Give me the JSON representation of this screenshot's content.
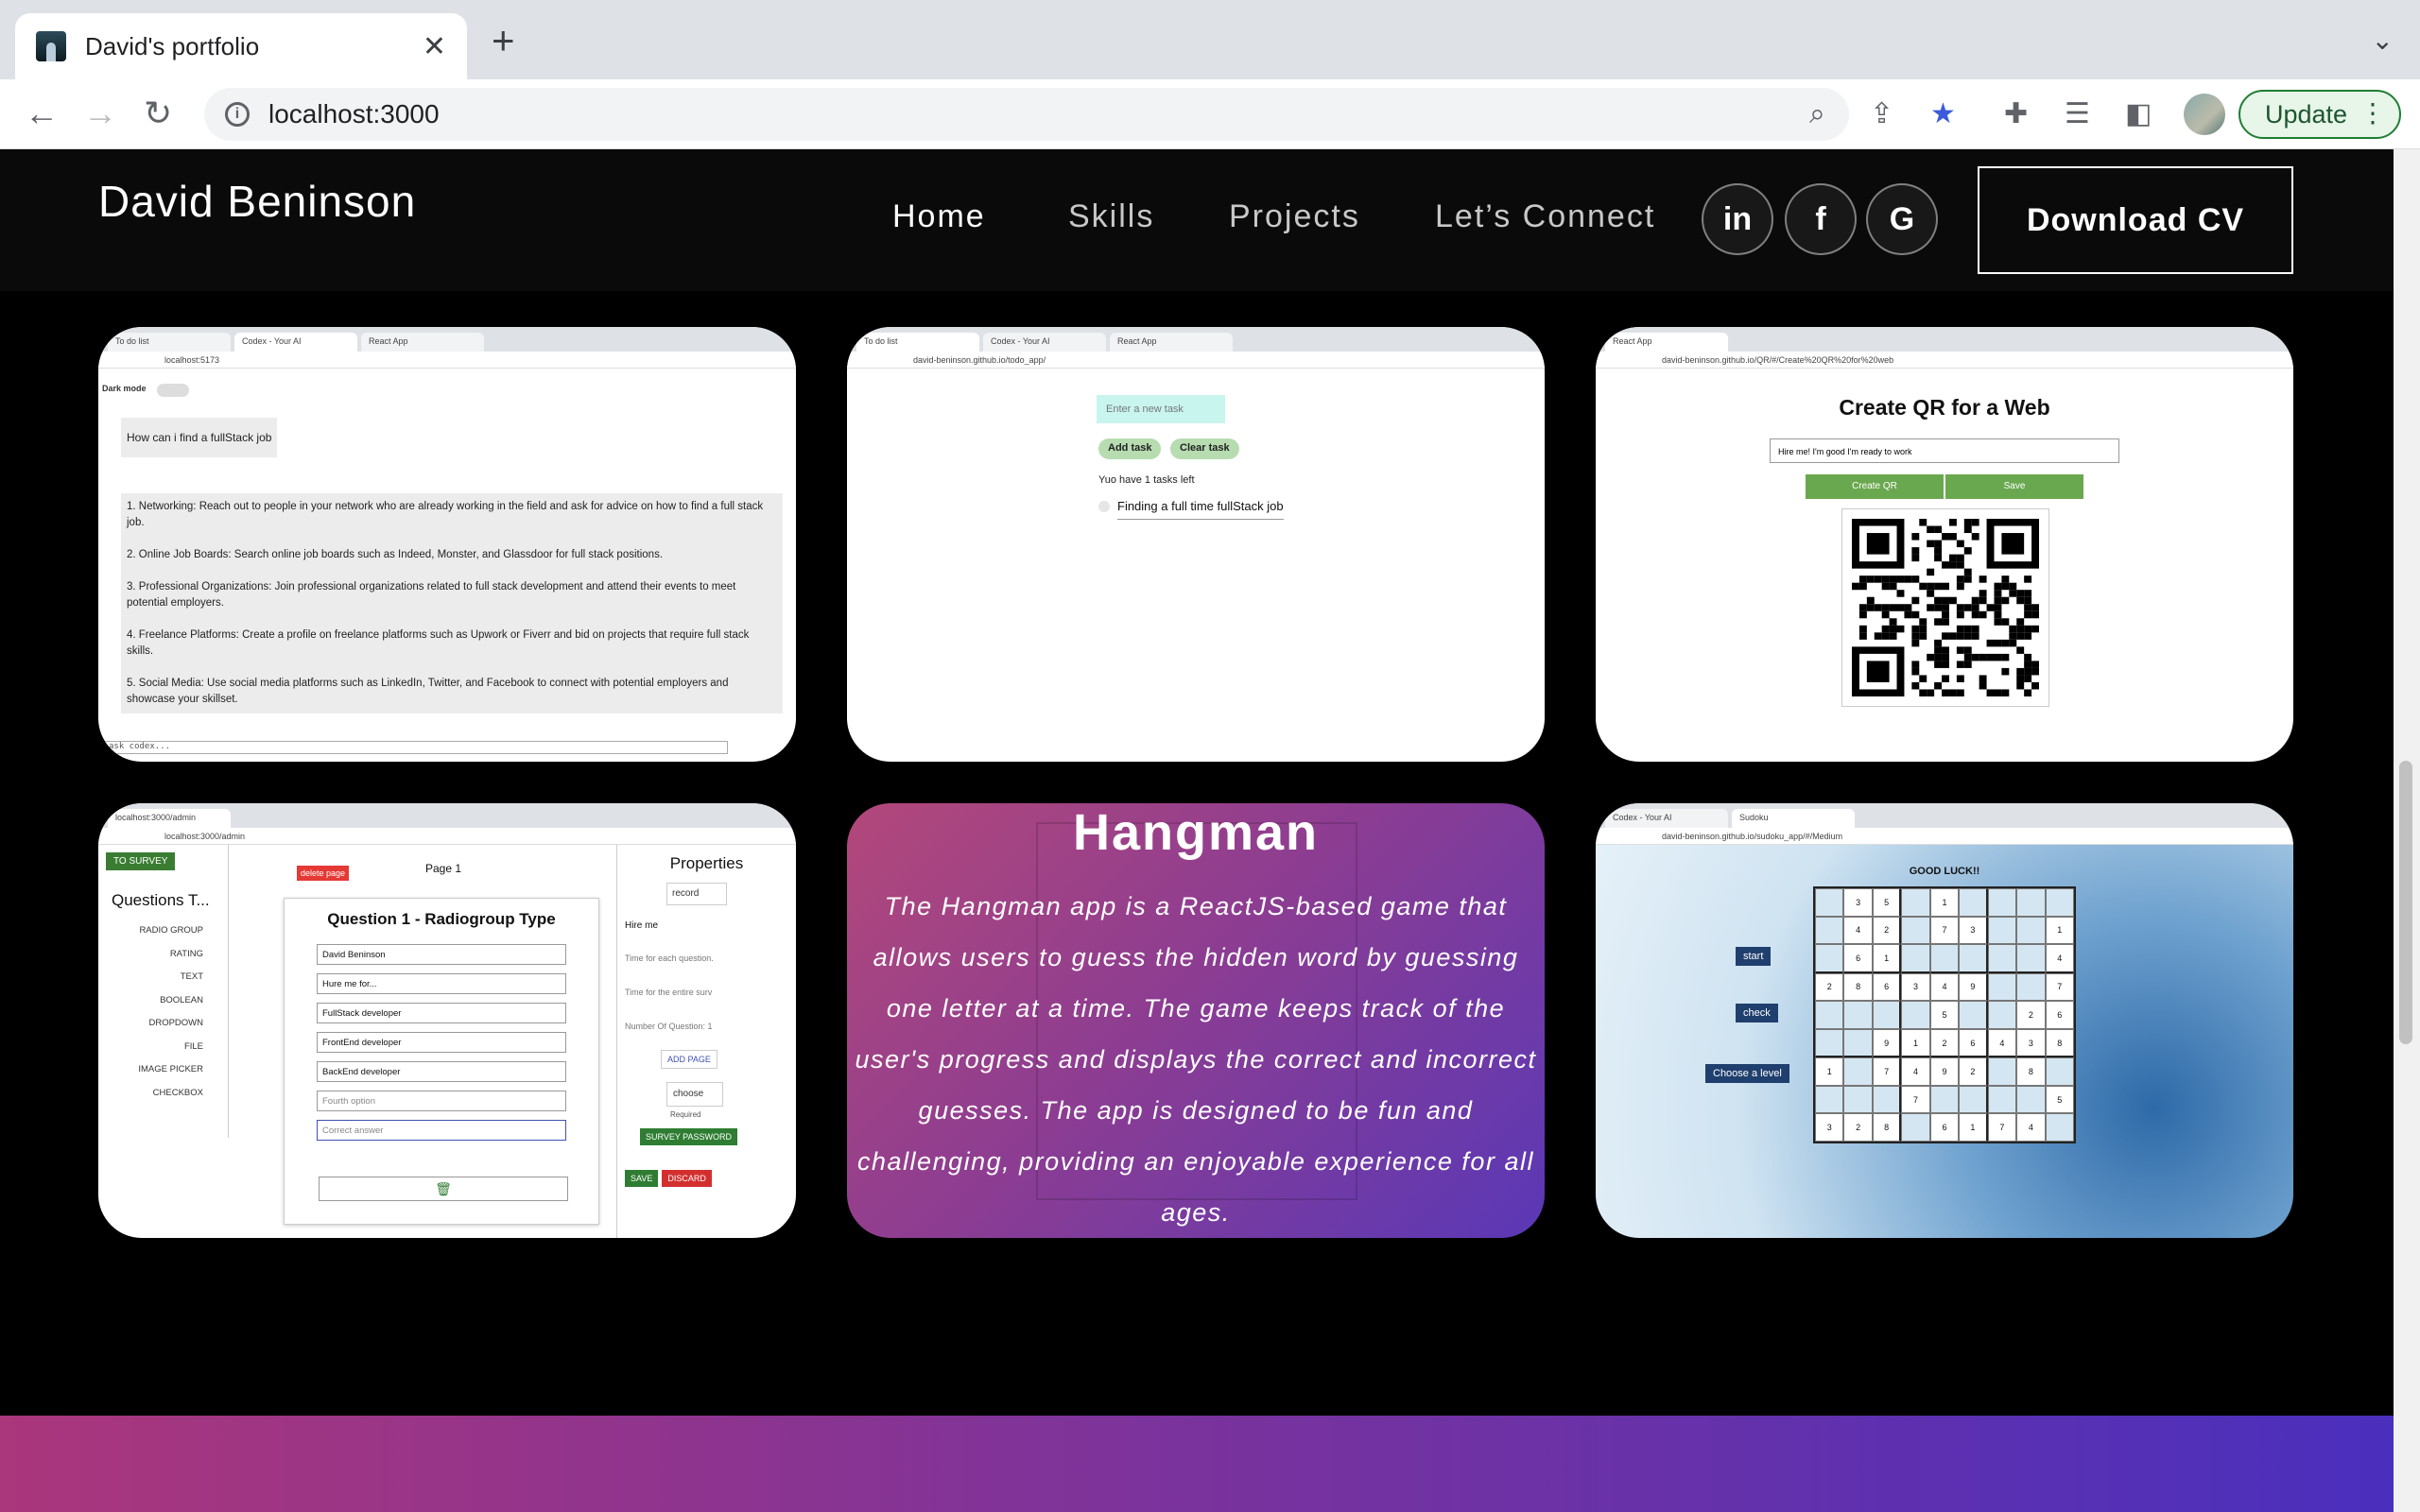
{
  "browser": {
    "tab_title": "David's portfolio",
    "new_tab": "+",
    "url": "localhost:3000",
    "update_label": "Update"
  },
  "site": {
    "brand": "David Beninson",
    "nav": [
      "Home",
      "Skills",
      "Projects",
      "Let’s Connect"
    ],
    "social": [
      "in",
      "f",
      "G"
    ],
    "download_cv": "Download CV"
  },
  "projects": {
    "codex": {
      "tabs": [
        "To do list",
        "Codex - Your AI",
        "React App"
      ],
      "url": "localhost:5173",
      "dark_mode": "Dark mode",
      "question": "How can i find a fullStack job",
      "answers": [
        "1. Networking: Reach out to people in your network who are already working in the field and ask for advice on how to find a full stack job.",
        "2. Online Job Boards: Search online job boards such as Indeed, Monster, and Glassdoor for full stack positions.",
        "3. Professional Organizations: Join professional organizations related to full stack development and attend their events to meet potential employers.",
        "4. Freelance Platforms: Create a profile on freelance platforms such as Upwork or Fiverr and bid on projects that require full stack skills.",
        "5. Social Media: Use social media platforms such as LinkedIn, Twitter, and Facebook to connect with potential employers and showcase your skillset."
      ],
      "input_placeholder": "ask codex..."
    },
    "todo": {
      "tabs": [
        "To do list",
        "Codex - Your AI",
        "React App"
      ],
      "url": "david-beninson.github.io/todo_app/",
      "placeholder": "Enter a new task",
      "add": "Add task",
      "clear": "Clear task",
      "count": "Yuo have 1 tasks left",
      "item": "Finding a full time fullStack job"
    },
    "qr": {
      "tabs": [
        "React App"
      ],
      "url": "david-beninson.github.io/QR/#/Create%20QR%20for%20web",
      "title": "Create QR for a Web",
      "input": "Hire me! I'm good I'm ready to work",
      "create": "Create QR",
      "save": "Save"
    },
    "survey": {
      "url": "localhost:3000/admin",
      "to_survey": "TO SURVEY",
      "questions_title": "Questions T...",
      "types": [
        "RADIO GROUP",
        "RATING",
        "TEXT",
        "BOOLEAN",
        "DROPDOWN",
        "FILE",
        "IMAGE PICKER",
        "CHECKBOX"
      ],
      "delete_page": "delete page",
      "page": "Page 1",
      "question_title": "Question 1 - Radiogroup Type",
      "options": [
        "David Beninson",
        "Hure me for...",
        "FullStack developer",
        "FrontEnd developer",
        "BackEnd developer",
        "Fourth option",
        "Correct answer"
      ],
      "properties": "Properties",
      "record": "record",
      "hire": "Hire me",
      "prop_fields": [
        "Time for each question.",
        "Time for the entire surv",
        "Number Of Question: 1"
      ],
      "add_page": "ADD PAGE",
      "choose": "choose",
      "required": "Required",
      "survey_password": "SURVEY PASSWORD",
      "save": "SAVE",
      "discard": "DISCARD"
    },
    "hangman": {
      "title": "Hangman",
      "description": "The Hangman app is a ReactJS-based game that allows users to guess the hidden word by guessing one letter at a time. The game keeps track of the user's progress and displays the correct and incorrect guesses. The app is designed to be fun and challenging, providing an enjoyable experience for all ages."
    },
    "sudoku": {
      "tabs": [
        "Codex - Your AI",
        "Sudoku"
      ],
      "url": "david-beninson.github.io/sudoku_app/#/Medium",
      "title": "GOOD LUCK!!",
      "start": "start",
      "check": "check",
      "level": "Choose a level",
      "grid": [
        [
          "",
          "3",
          "5",
          "",
          "1",
          "",
          "",
          "",
          ""
        ],
        [
          "",
          "4",
          "2",
          "",
          "7",
          "3",
          "",
          "",
          "1"
        ],
        [
          "",
          "6",
          "1",
          "",
          "",
          "",
          "",
          "",
          "4"
        ],
        [
          "2",
          "8",
          "6",
          "3",
          "4",
          "9",
          "",
          "",
          "7"
        ],
        [
          "",
          "",
          "",
          "",
          "5",
          "",
          "",
          "2",
          "6"
        ],
        [
          "",
          "",
          "9",
          "1",
          "2",
          "6",
          "4",
          "3",
          "8"
        ],
        [
          "1",
          "",
          "7",
          "4",
          "9",
          "2",
          "",
          "8",
          ""
        ],
        [
          "",
          "",
          "",
          "7",
          "",
          "",
          "",
          "",
          "5"
        ],
        [
          "3",
          "2",
          "8",
          "",
          "6",
          "1",
          "7",
          "4",
          ""
        ]
      ]
    }
  },
  "colors": {
    "accent_from": "#aa367c",
    "accent_to": "#4a2fbd"
  }
}
